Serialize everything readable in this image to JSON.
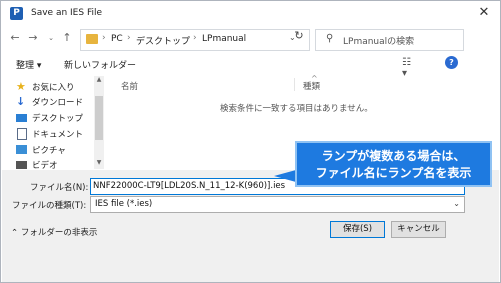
{
  "window": {
    "title": "Save an IES File",
    "app_icon_letter": "P",
    "close_glyph": "✕"
  },
  "address": {
    "crumbs": [
      "PC",
      "デスクトップ",
      "LPmanual"
    ],
    "separator": "›"
  },
  "search": {
    "placeholder": "LPmanualの検索"
  },
  "toolbar": {
    "organize": "整理 ▾",
    "new_folder": "新しいフォルダー",
    "help": "?"
  },
  "nav": {
    "items": [
      {
        "label": "お気に入り",
        "icon": "star-icon",
        "color": "#e8b21c"
      },
      {
        "label": "ダウンロード",
        "icon": "download-icon",
        "color": "#2a6ad1"
      },
      {
        "label": "デスクトップ",
        "icon": "desktop-icon",
        "color": "#2a7fd4"
      },
      {
        "label": "ドキュメント",
        "icon": "document-icon",
        "color": "#5a6c88"
      },
      {
        "label": "ピクチャ",
        "icon": "pictures-icon",
        "color": "#3a8fd6"
      },
      {
        "label": "ビデオ",
        "icon": "video-icon",
        "color": "#555555"
      }
    ]
  },
  "filelist": {
    "col_name": "名前",
    "col_type": "種類",
    "empty_message": "検索条件に一致する項目はありません。"
  },
  "footer": {
    "filename_label": "ファイル名(N):",
    "filename_value": "NNF22000C-LT9[LDL20S.N_11_12-K(960)].ies",
    "filetype_label": "ファイルの種類(T):",
    "filetype_value": "IES file (*.ies)",
    "hide_folders": "フォルダーの非表示",
    "save": "保存(S)",
    "cancel": "キャンセル"
  },
  "callout": {
    "line1": "ランプが複数ある場合は、",
    "line2": "ファイル名にランプ名を表示"
  }
}
